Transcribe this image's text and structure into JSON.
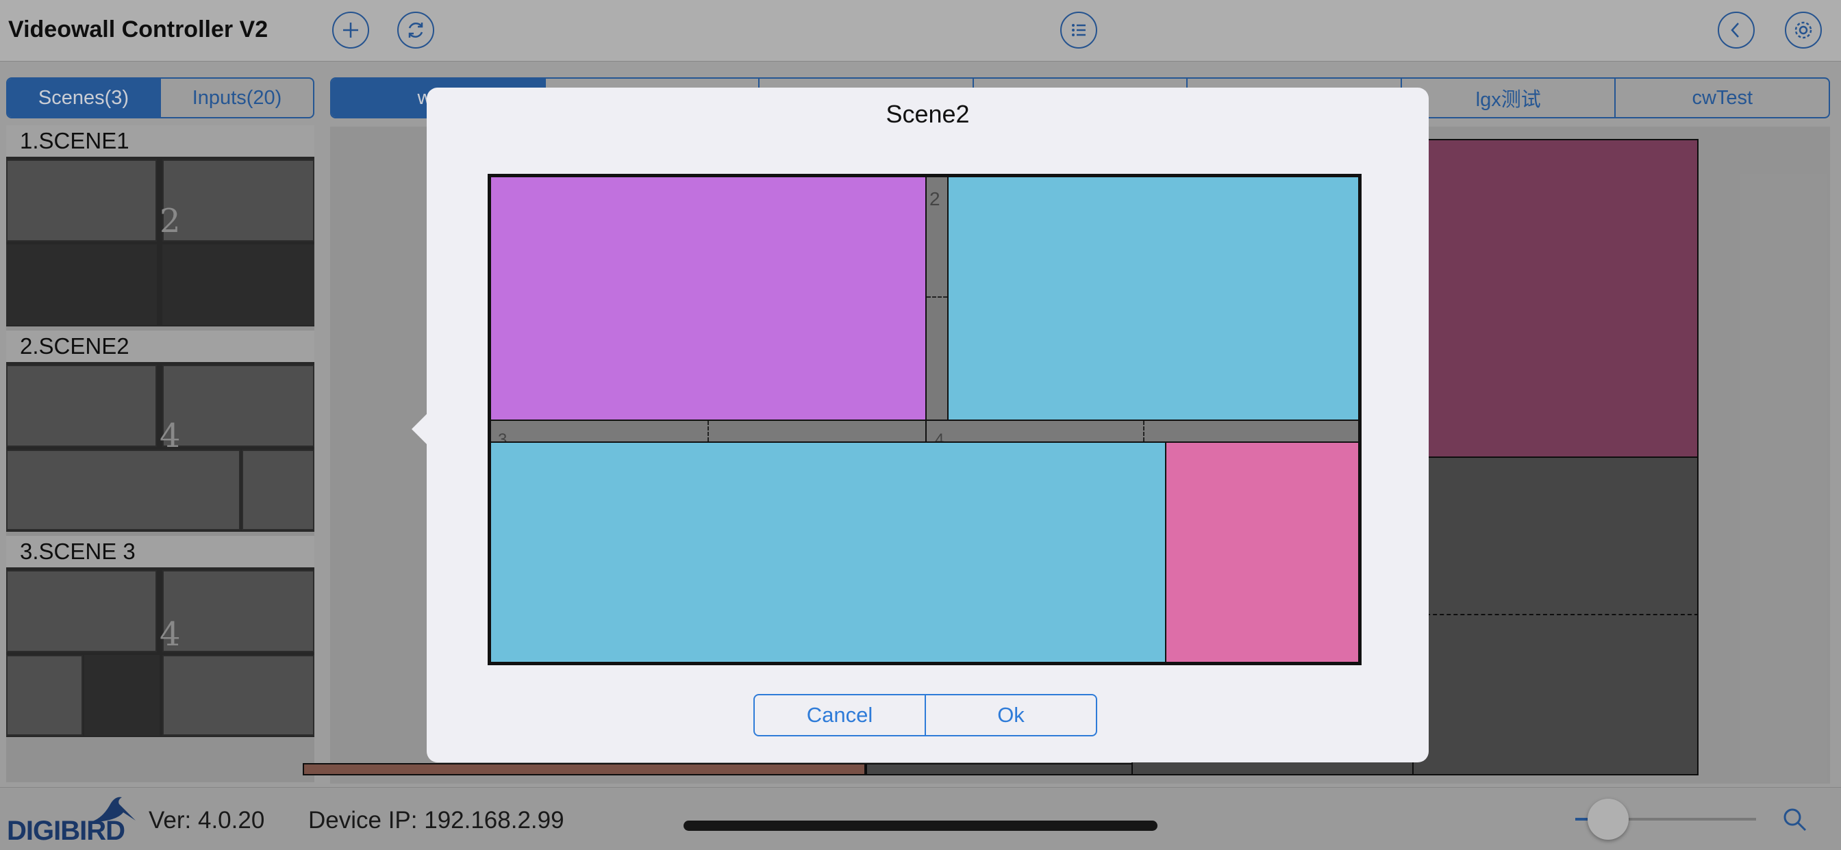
{
  "header": {
    "title": "Videowall Controller V2",
    "buttons": [
      "add-icon",
      "refresh-icon",
      "list-icon",
      "back-icon",
      "settings-icon"
    ]
  },
  "left_panel": {
    "segments": [
      {
        "label": "Scenes(3)",
        "selected": true
      },
      {
        "label": "Inputs(20)",
        "selected": false
      }
    ],
    "scenes": [
      {
        "label": "1.SCENE1",
        "thumb_number": "2"
      },
      {
        "label": "2.SCENE2",
        "thumb_number": "4"
      },
      {
        "label": "3.SCENE 3",
        "thumb_number": "4"
      }
    ]
  },
  "tabs": [
    "wanj",
    "",
    "",
    "",
    "",
    "lgx测试",
    "cwTest"
  ],
  "wall": {
    "visible_number": "3"
  },
  "popover": {
    "title": "Scene2",
    "window_labels": [
      "2",
      "3",
      "4"
    ],
    "cancel_label": "Cancel",
    "ok_label": "Ok"
  },
  "footer": {
    "logo": "DIGIBIRD",
    "version": "Ver: 4.0.20",
    "device_ip": "Device IP: 192.168.2.99",
    "zoom_level": 0.18
  },
  "colors": {
    "accent": "#2b62a8",
    "purple": "#c171de",
    "cyan": "#6ec0dc",
    "pink": "#dd6ea8",
    "wall_maroon": "#834262"
  }
}
